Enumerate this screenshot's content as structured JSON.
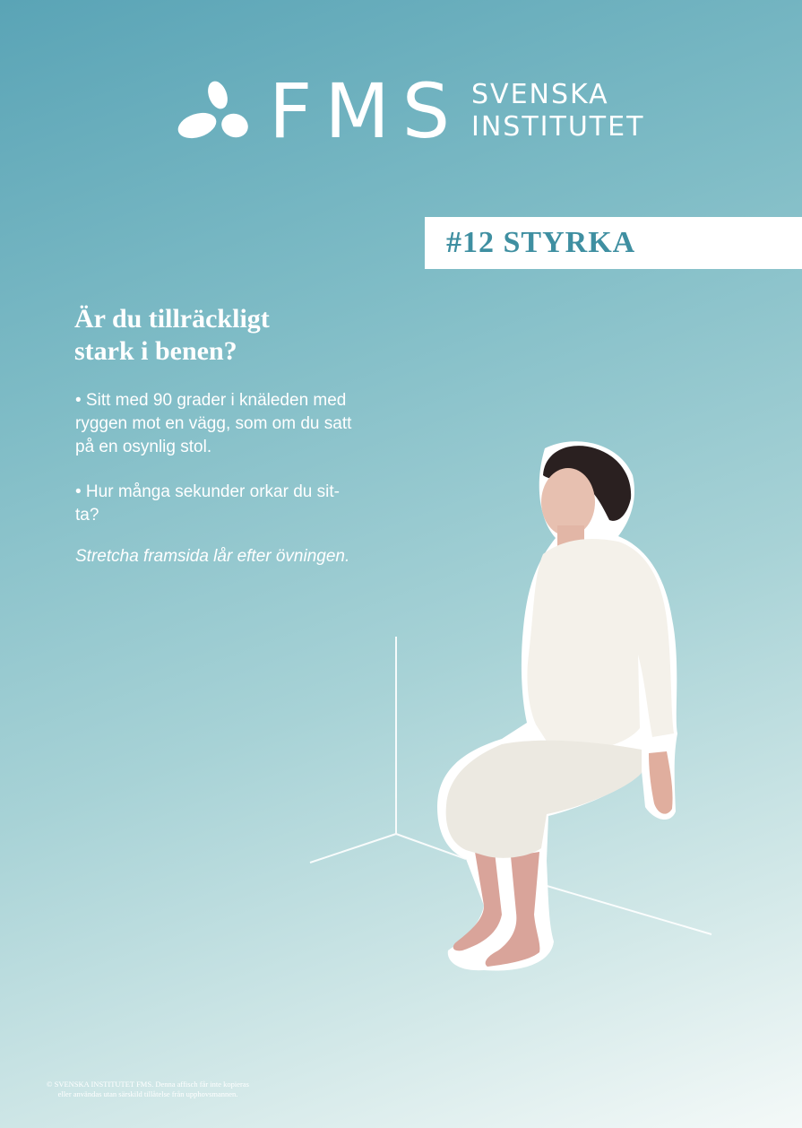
{
  "logo": {
    "brand": "FMS",
    "sub_line1": "SVENSKA",
    "sub_line2": "INSTITUTET",
    "mark_icon": "three-leaf-logo-icon"
  },
  "tag": "#12 STYRKA",
  "heading": {
    "line1": "Är du tillräckligt",
    "line2": "stark i benen?"
  },
  "bullets": [
    {
      "line1": "• Sitt med 90 grader i knäleden med",
      "line2": "ryggen mot en vägg, som om du satt",
      "line3": "på en osynlig stol."
    },
    {
      "line1": "• Hur många sekunder orkar du sit-",
      "line2": "ta?"
    }
  ],
  "note": "Stretcha framsida lår efter övningen.",
  "copyright": {
    "line1": "© SVENSKA INSTITUTET FMS. Denna affisch får inte kopieras",
    "line2": "eller användas utan särskild tillåtelse från upphovsmannen."
  },
  "colors": {
    "background_top": "#5aa4b6",
    "background_bottom": "#f4f9f8",
    "accent_text": "#3f8fa1",
    "text": "#ffffff"
  }
}
